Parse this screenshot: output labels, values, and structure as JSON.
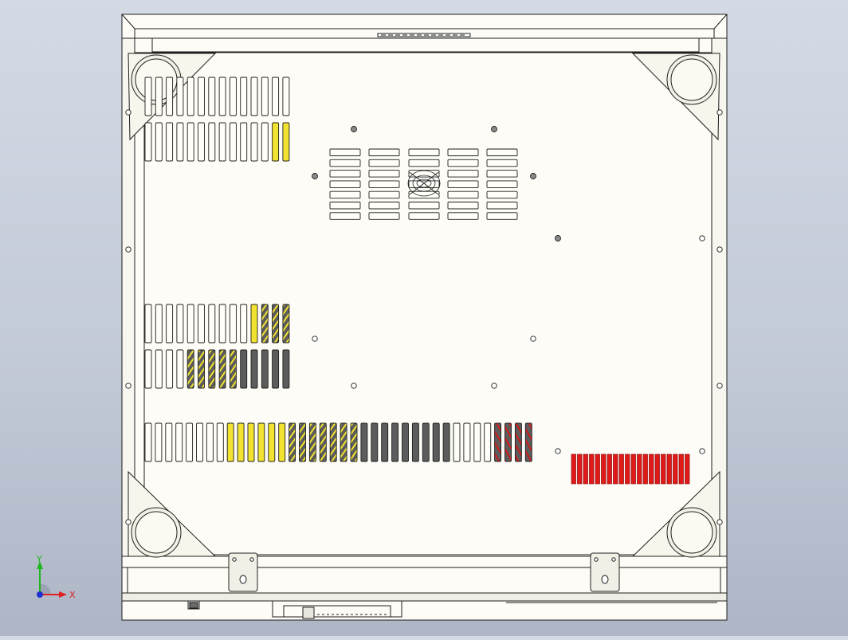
{
  "model": {
    "name": "chassis-bottom-view",
    "colors": {
      "background_top": "#d4dae5",
      "background_bottom": "#aeb6c6",
      "body_fill": "#fdfcf7",
      "edge": "#1e1e1e",
      "slot_fill": "#fffef8",
      "fill_yellow": "#f2e330",
      "fill_dark": "#5c5c5c",
      "fill_red": "#cf1a1a",
      "vent_red": "#e01919",
      "vent_red_edge": "#8c0a0a"
    },
    "vent_groups": [
      {
        "id": "vent-top-left-upper",
        "slots": 14
      },
      {
        "id": "vent-top-left-lower",
        "slots": 14
      },
      {
        "id": "vent-mid-left-upper",
        "slots": 14
      },
      {
        "id": "vent-mid-left-lower",
        "slots": 14
      },
      {
        "id": "vent-bottom-long",
        "slots": 38
      },
      {
        "id": "vent-red-grille",
        "slots": 20
      },
      {
        "id": "fan-grille",
        "slots": 35
      }
    ],
    "feet": [
      "foot-top-left",
      "foot-top-right",
      "foot-bottom-left",
      "foot-bottom-right"
    ],
    "brackets": [
      "hinge-bracket-left",
      "hinge-bracket-right"
    ]
  },
  "triad": {
    "x_label": "X",
    "y_label": "Y",
    "x_color": "#e02020",
    "y_color": "#1fb51f",
    "z_color": "#2030d0"
  }
}
